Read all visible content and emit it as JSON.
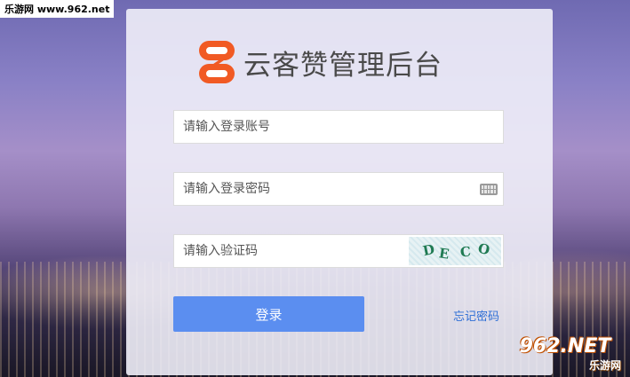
{
  "watermarks": {
    "top_left": "乐游网 www.962.net",
    "bottom_right_logo": "962.NET",
    "bottom_right_text": "乐游网"
  },
  "brand": {
    "title": "云客赞管理后台",
    "logo_icon": "brand-logo-icon",
    "logo_color": "#f15a24"
  },
  "form": {
    "account_placeholder": "请输入登录账号",
    "password_placeholder": "请输入登录密码",
    "captcha_placeholder": "请输入验证码",
    "captcha_chars": "DECO"
  },
  "actions": {
    "login_label": "登录",
    "forgot_label": "忘记密码"
  },
  "colors": {
    "login_button": "#5b8ef0",
    "link": "#2f6fd6"
  }
}
